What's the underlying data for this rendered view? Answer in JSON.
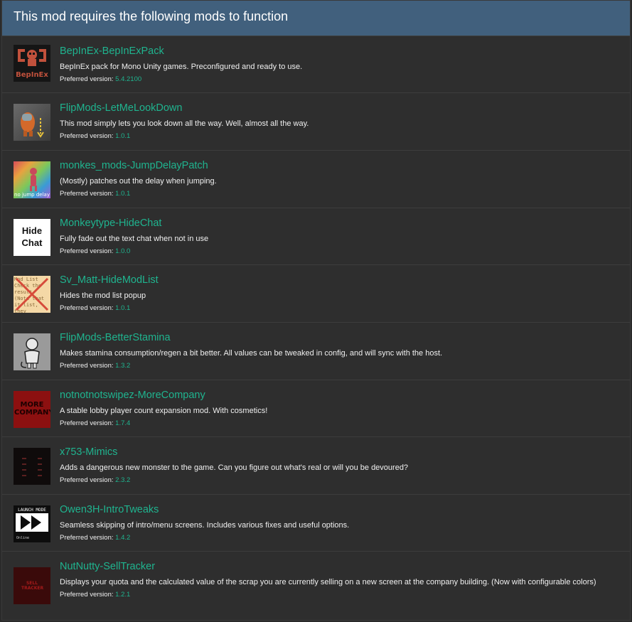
{
  "header": {
    "title": "This mod requires the following mods to function"
  },
  "preferred_label": "Preferred version:",
  "mods": [
    {
      "name": "BepInEx-BepInExPack",
      "description": "BepInEx pack for Mono Unity games. Preconfigured and ready to use.",
      "version": "5.4.2100",
      "thumb_text": "BepInEx"
    },
    {
      "name": "FlipMods-LetMeLookDown",
      "description": "This mod simply lets you look down all the way. Well, almost all the way.",
      "version": "1.0.1"
    },
    {
      "name": "monkes_mods-JumpDelayPatch",
      "description": "(Mostly) patches out the delay when jumping.",
      "version": "1.0.1",
      "thumb_text": "no jump delay"
    },
    {
      "name": "Monkeytype-HideChat",
      "description": "Fully fade out the text chat when not in use",
      "version": "1.0.0",
      "thumb_text": "Hide Chat"
    },
    {
      "name": "Sv_Matt-HideModList",
      "description": "Hides the mod list popup",
      "version": "1.0.1",
      "thumb_text": "Mod List Check the result. (Note that it list, they"
    },
    {
      "name": "FlipMods-BetterStamina",
      "description": "Makes stamina consumption/regen a bit better. All values can be tweaked in config, and will sync with the host.",
      "version": "1.3.2"
    },
    {
      "name": "notnotnotswipez-MoreCompany",
      "description": "A stable lobby player count expansion mod. With cosmetics!",
      "version": "1.7.4",
      "thumb_text": "MORE COMPANY"
    },
    {
      "name": "x753-Mimics",
      "description": "Adds a dangerous new monster to the game. Can you figure out what's real or will you be devoured?",
      "version": "2.3.2"
    },
    {
      "name": "Owen3H-IntroTweaks",
      "description": "Seamless skipping of intro/menu screens. Includes various fixes and useful options.",
      "version": "1.4.2",
      "thumb_text": "LAUNCH MODE",
      "thumb_text2": "Online"
    },
    {
      "name": "NutNutty-SellTracker",
      "description": "Displays your quota and the calculated value of the scrap you are currently selling on a new screen at the company building. (Now with configurable colors)",
      "version": "1.2.1",
      "thumb_text": "SELL TRACKER"
    }
  ]
}
